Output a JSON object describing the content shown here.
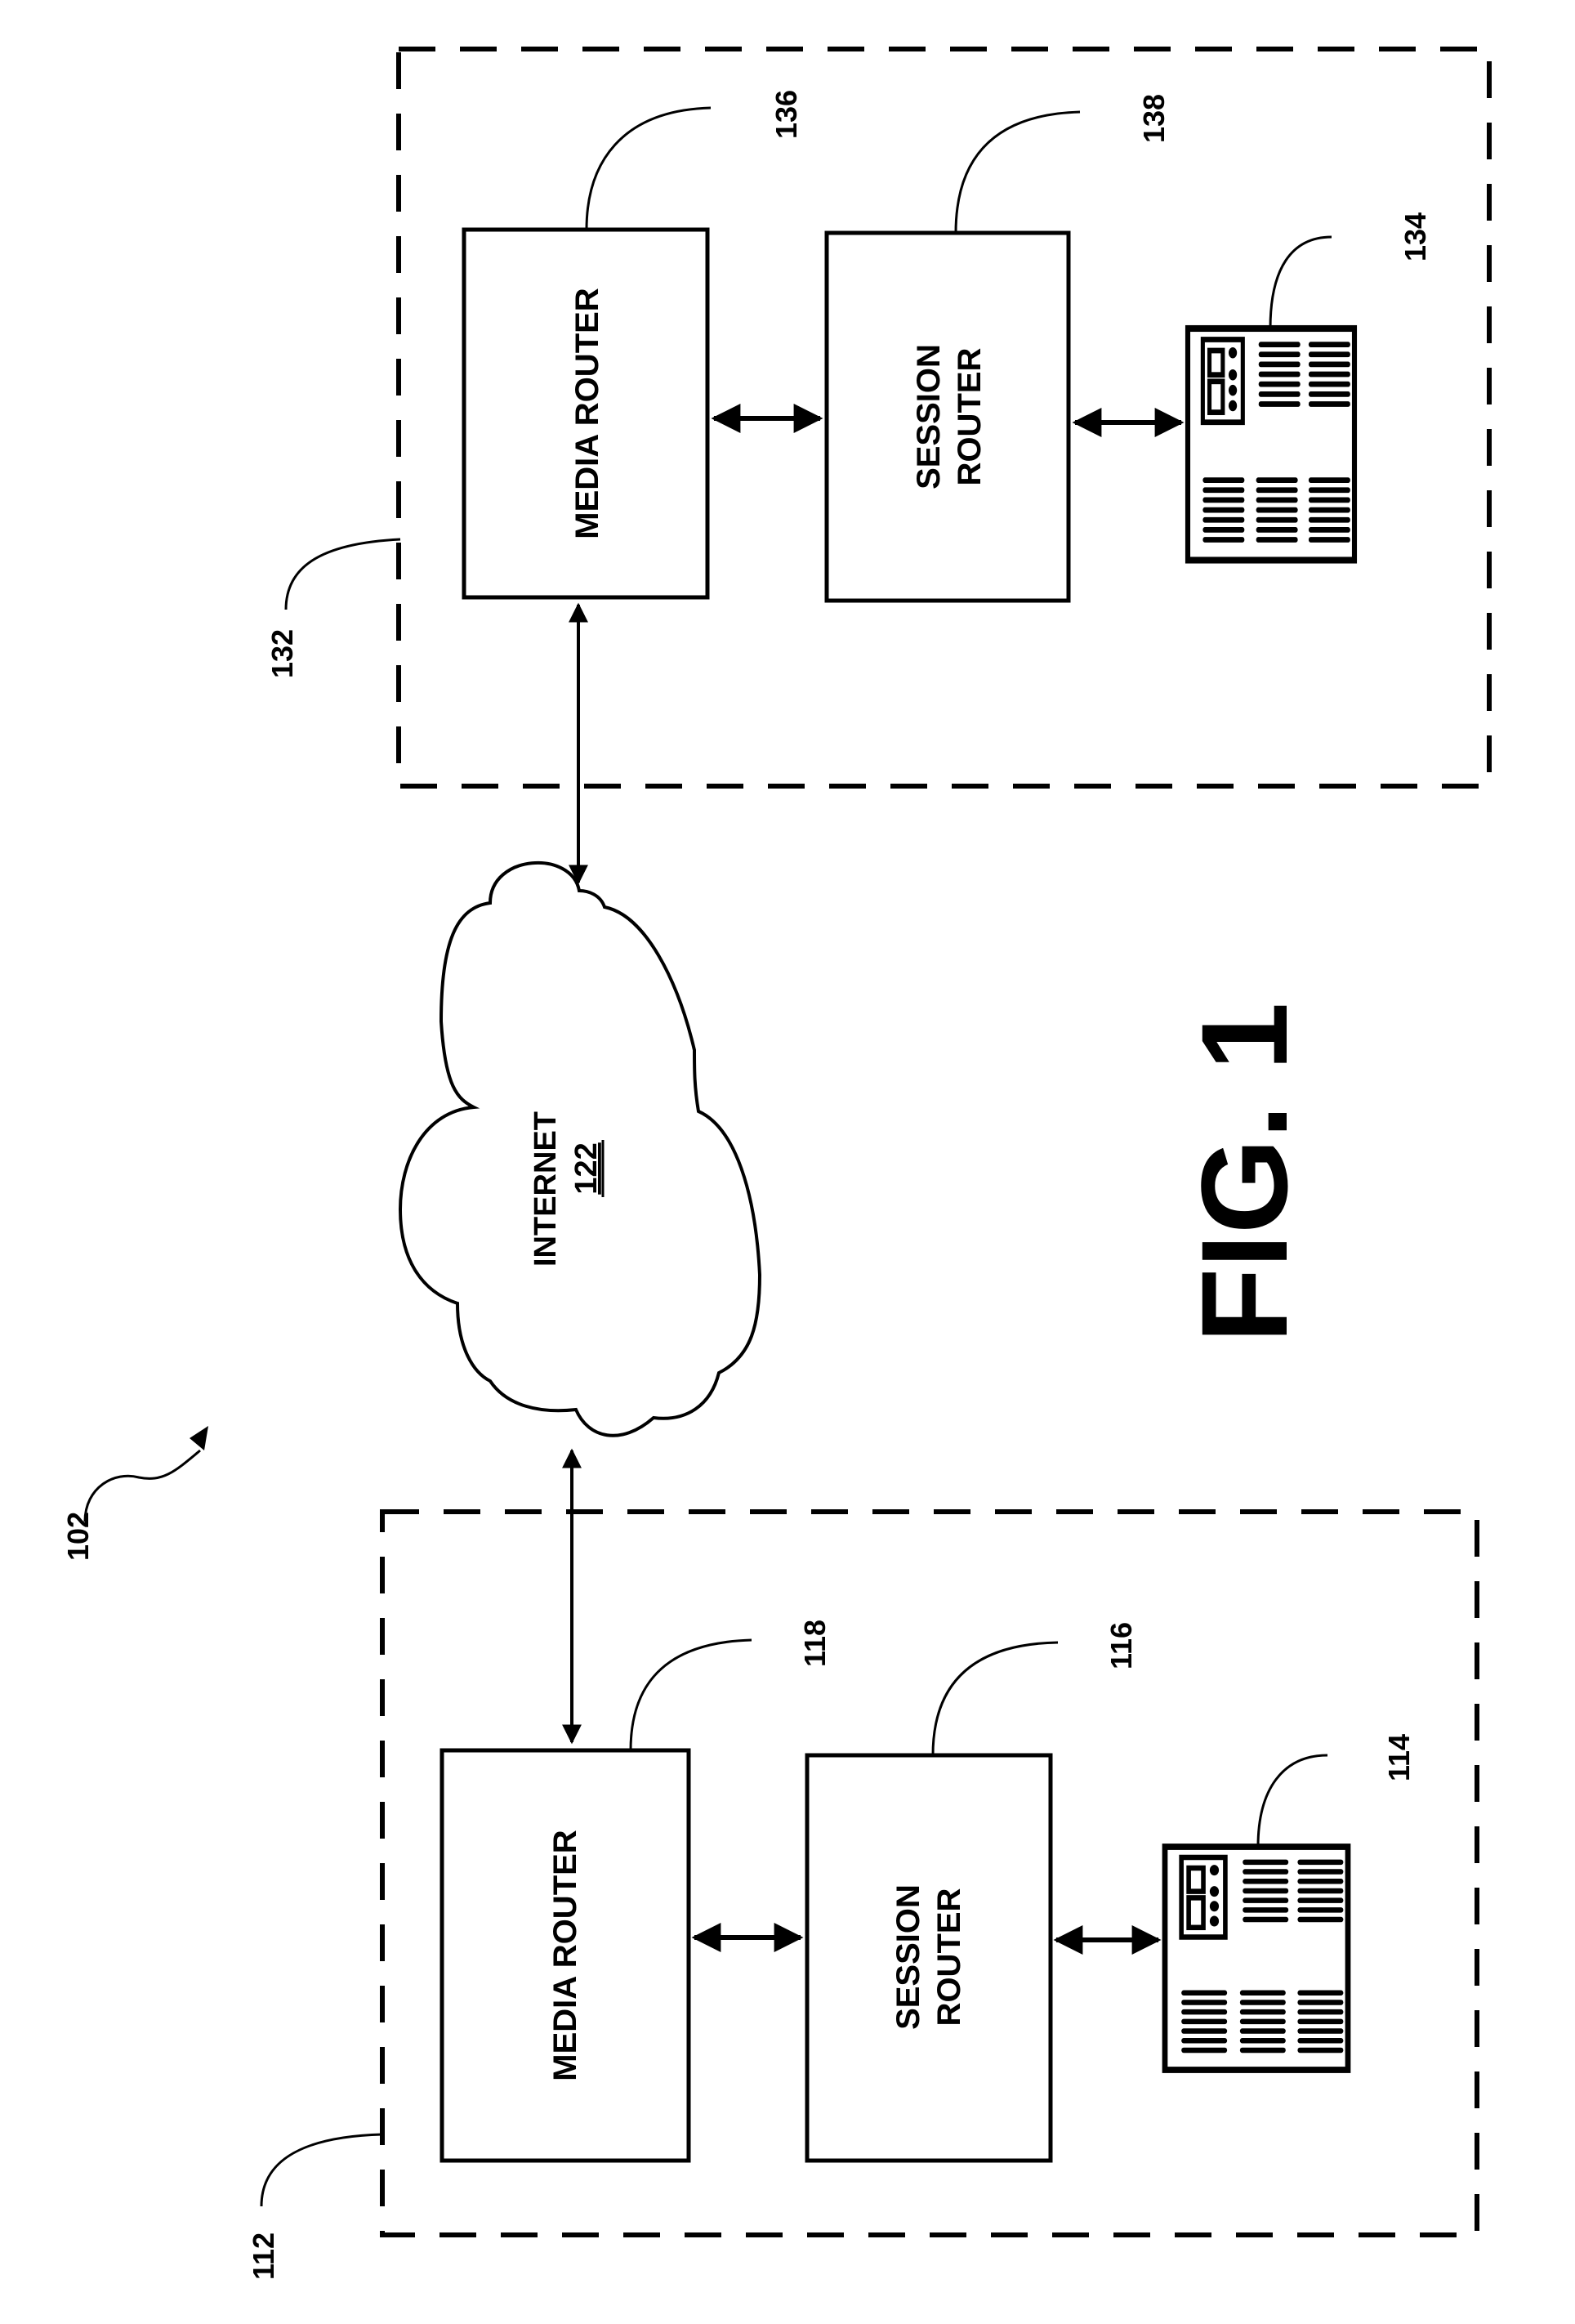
{
  "figure": {
    "title": "FIG. 1",
    "system_ref": "102"
  },
  "internet": {
    "label": "INTERNET",
    "ref": "122"
  },
  "sites": [
    {
      "ref": "132",
      "media_router": {
        "label": "MEDIA ROUTER",
        "ref": "136"
      },
      "session_router": {
        "label_line1": "SESSION",
        "label_line2": "ROUTER",
        "ref": "138"
      },
      "device": {
        "icon": "ip-phone-icon",
        "ref": "134"
      }
    },
    {
      "ref": "112",
      "media_router": {
        "label": "MEDIA ROUTER",
        "ref": "118"
      },
      "session_router": {
        "label_line1": "SESSION",
        "label_line2": "ROUTER",
        "ref": "116"
      },
      "device": {
        "icon": "ip-phone-icon",
        "ref": "114"
      }
    }
  ],
  "colors": {
    "ink": "#000000",
    "paper": "#ffffff"
  }
}
